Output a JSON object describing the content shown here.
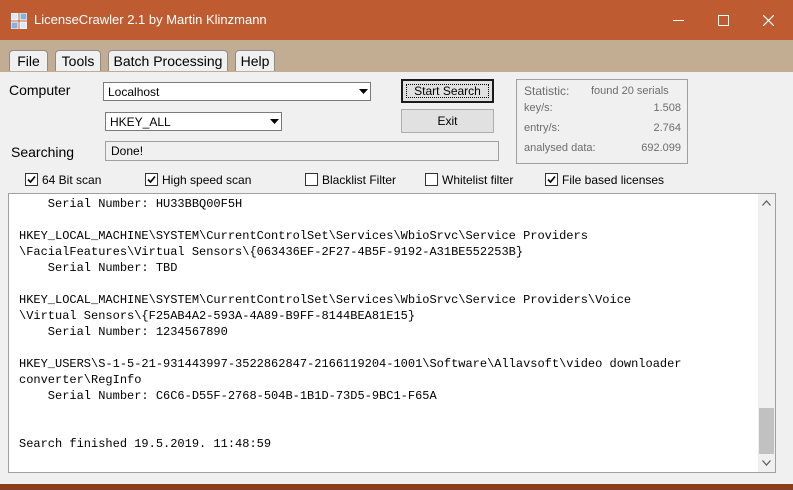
{
  "window": {
    "title": "LicenseCrawler 2.1 by Martin Klinzmann"
  },
  "tabs": [
    "File",
    "Tools",
    "Batch Processing",
    "Help"
  ],
  "form": {
    "computer_label": "Computer",
    "computer_value": "Localhost",
    "hive_value": "HKEY_ALL",
    "searching_label": "Searching",
    "status_value": "Done!"
  },
  "buttons": {
    "start_search": "Start Search",
    "exit": "Exit"
  },
  "statistic": {
    "title": "Statistic:",
    "found": "found 20 serials",
    "rows": [
      {
        "key": "key/s:",
        "value": "1.508"
      },
      {
        "key": "entry/s:",
        "value": "2.764"
      },
      {
        "key": "analysed data:",
        "value": "692.099"
      }
    ]
  },
  "options": [
    {
      "label": "64 Bit scan",
      "checked": true
    },
    {
      "label": "High speed scan",
      "checked": true
    },
    {
      "label": "Blacklist Filter",
      "checked": false
    },
    {
      "label": "Whitelist filter",
      "checked": false
    },
    {
      "label": "File based licenses",
      "checked": true
    }
  ],
  "output_lines": [
    "    Serial Number: HU33BBQ00F5H",
    "",
    "HKEY_LOCAL_MACHINE\\SYSTEM\\CurrentControlSet\\Services\\WbioSrvc\\Service Providers",
    "\\FacialFeatures\\Virtual Sensors\\{063436EF-2F27-4B5F-9192-A31BE552253B}",
    "    Serial Number: TBD",
    "",
    "HKEY_LOCAL_MACHINE\\SYSTEM\\CurrentControlSet\\Services\\WbioSrvc\\Service Providers\\Voice",
    "\\Virtual Sensors\\{F25AB4A2-593A-4A89-B9FF-8144BEA81E15}",
    "    Serial Number: 1234567890",
    "",
    "HKEY_USERS\\S-1-5-21-931443997-3522862847-2166119204-1001\\Software\\Allavsoft\\video downloader",
    "converter\\RegInfo",
    "    Serial Number: C6C6-D55F-2768-504B-1B1D-73D5-9BC1-F65A",
    "",
    "",
    "Search finished 19.5.2019. 11:48:59"
  ],
  "colors": {
    "titlebar": "#bf5b30",
    "tabbar": "#c3ad92"
  }
}
